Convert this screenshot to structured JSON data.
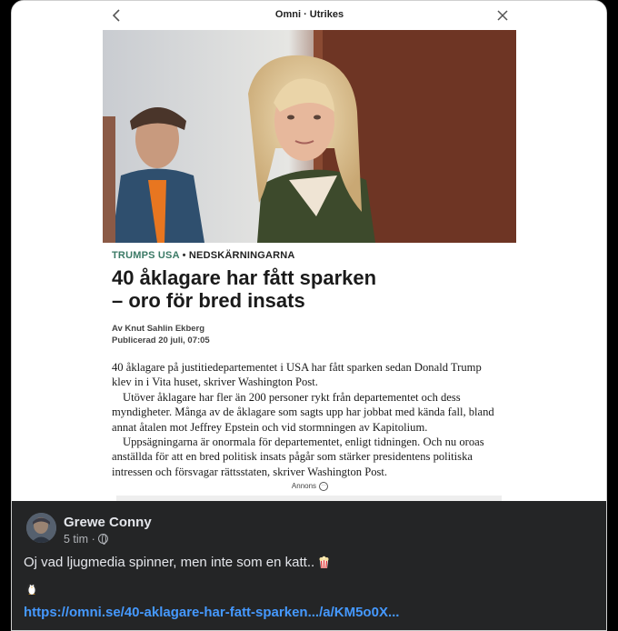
{
  "topbar": {
    "title": "Omni · Utrikes",
    "back_icon": "chevron-left-icon",
    "close_icon": "close-icon"
  },
  "article": {
    "kicker_tag": "TRUMPS USA",
    "kicker_sep": " • ",
    "kicker_topic": "NEDSKÄRNINGARNA",
    "headline_line1": "40 åklagare har fått sparken",
    "headline_line2": "– oro för bred insats",
    "author": "Av Knut Sahlin Ekberg",
    "published": "Publicerad 20 juli, 07:05",
    "paragraphs": [
      "40 åklagare på justitiedepartementet i USA har fått sparken sedan Donald Trump klev in i Vita huset, skriver Washington Post.",
      "Utöver åklagare har fler än 200 personer rykt från departementet och dess myndigheter. Många av de åklagare som sagts upp har jobbat med kända fall, bland annat åtalen mot Jeffrey Epstein och vid stormningen av Kapitolium.",
      "Uppsägningarna är onormala för departementet, enligt tidningen. Och nu oroas anställda för att en bred politisk insats pågår som stärker presidentens politiska intressen och försvagar rättsstaten, skriver Washington Post."
    ],
    "ad_label": "Annons"
  },
  "post": {
    "author": "Grewe Conny",
    "time": "5 tim",
    "meta_sep": " · ",
    "text": "Oj vad ljugmedia spinner, men inte som en katt..",
    "link": "https://omni.se/40-aklagare-har-fatt-sparken.../a/KM5o0X..."
  },
  "colors": {
    "kicker_accent": "#3b7a66",
    "post_background": "#242526",
    "link": "#4599ff"
  }
}
